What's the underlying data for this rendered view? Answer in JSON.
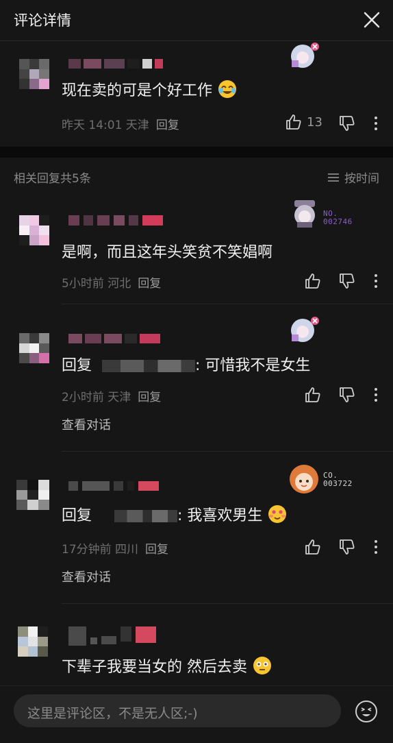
{
  "header": {
    "title": "评论详情",
    "close_icon": "close-icon"
  },
  "main_comment": {
    "text": "现在卖的可是个好工作",
    "emoji": "laughing-crying-emoji",
    "time": "昨天 14:01 天津",
    "reply_label": "回复",
    "like_count": "13"
  },
  "replies_header": {
    "label": "相关回复共5条",
    "sort_label": "按时间"
  },
  "replies": [
    {
      "text": "是啊，而且这年头笑贫不笑娼啊",
      "badge_no": "NO.\n002746",
      "time": "5小时前 河北",
      "reply_label": "回复"
    },
    {
      "prefix": "回复",
      "suffix": ": 可惜我不是女生",
      "time": "2小时前 天津",
      "reply_label": "回复",
      "view_conversation": "查看对话"
    },
    {
      "prefix": "回复",
      "suffix": ": 我喜欢男生",
      "emoji": "shy-smile-emoji",
      "badge_no": "CO.\n003722",
      "time": "17分钟前 四川",
      "reply_label": "回复",
      "view_conversation": "查看对话"
    },
    {
      "text": "下辈子我要当女的 然后去卖",
      "emoji": "flushed-emoji"
    }
  ],
  "footer": {
    "placeholder": "这里是评论区，不是无人区;-)",
    "emoji_button_icon": "emoji-icon"
  },
  "colors": {
    "background": "#161616",
    "divider": "#0a0a0a",
    "muted": "#6f6f6f",
    "text": "#f0f0f0"
  }
}
